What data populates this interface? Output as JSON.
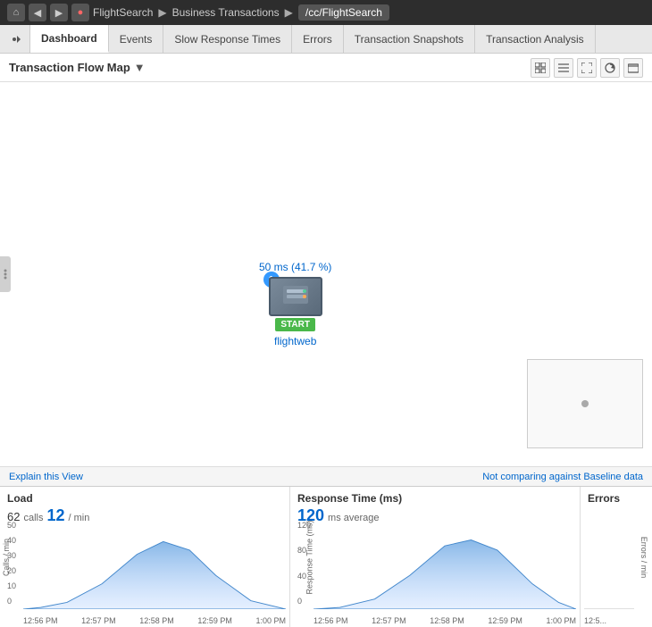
{
  "topnav": {
    "home_icon": "⌂",
    "back_icon": "◀",
    "forward_icon": "▶",
    "record_icon": "●",
    "breadcrumbs": [
      "FlightSearch",
      "Business Transactions",
      "/cc/FlightSearch"
    ]
  },
  "tabs": {
    "items": [
      {
        "label": "Dashboard",
        "active": true
      },
      {
        "label": "Events",
        "active": false
      },
      {
        "label": "Slow Response Times",
        "active": false
      },
      {
        "label": "Errors",
        "active": false
      },
      {
        "label": "Transaction Snapshots",
        "active": false
      },
      {
        "label": "Transaction Analysis",
        "active": false
      }
    ]
  },
  "flow_map": {
    "title": "Transaction Flow Map",
    "dropdown_icon": "▼",
    "header_icons": [
      "grid-icon",
      "table-icon",
      "expand-icon",
      "refresh-icon",
      "window-icon"
    ]
  },
  "node": {
    "label_above": "50 ms (41.7 %)",
    "badge_count": "1",
    "start_label": "START",
    "name": "flightweb"
  },
  "status_bar": {
    "explain_link": "Explain this View",
    "baseline_text": "Not comparing against Baseline data"
  },
  "charts": [
    {
      "id": "load",
      "title": "Load",
      "big_num": "62",
      "big_unit": "calls",
      "secondary_num": "12",
      "secondary_unit": "/ min",
      "y_labels": [
        "50",
        "40",
        "30",
        "20",
        "10",
        "0"
      ],
      "x_labels": [
        "12:56 PM",
        "12:57 PM",
        "12:58 PM",
        "12:59 PM",
        "1:00 PM"
      ],
      "y_axis_label": "Calls / min"
    },
    {
      "id": "response_time",
      "title": "Response Time (ms)",
      "big_num": "120",
      "big_unit": "ms average",
      "secondary_num": "",
      "secondary_unit": "",
      "y_labels": [
        "120",
        "80",
        "40",
        "0"
      ],
      "x_labels": [
        "12:56 PM",
        "12:57 PM",
        "12:58 PM",
        "12:59 PM",
        "1:00 PM"
      ],
      "y_axis_label": "Response Time (ms)"
    },
    {
      "id": "errors",
      "title": "Errors",
      "big_num": "",
      "y_axis_label": "Errors / min",
      "x_labels": [
        "12:5"
      ]
    }
  ]
}
